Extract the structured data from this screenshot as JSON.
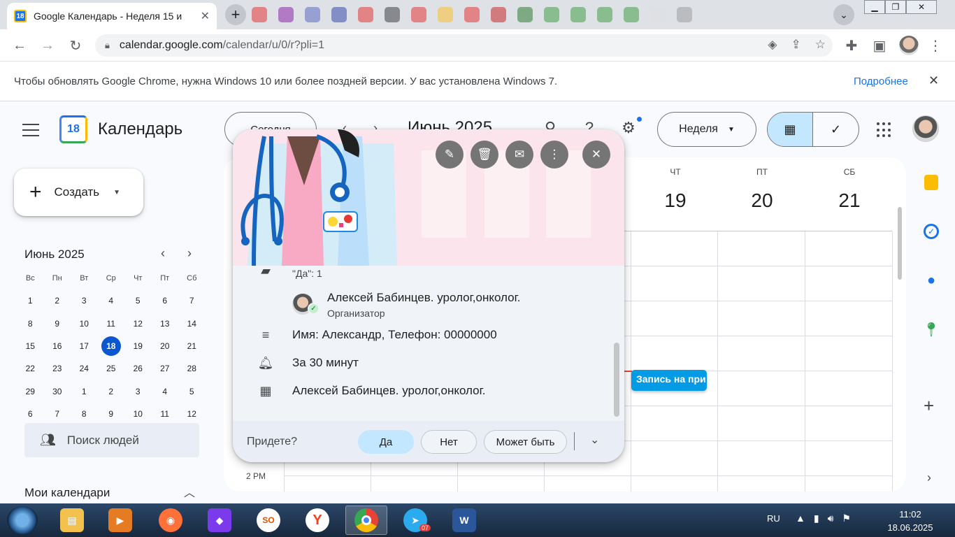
{
  "browser": {
    "tab_title": "Google Календарь - Неделя 15 и",
    "tab_favicon_day": "18",
    "url_host": "calendar.google.com",
    "url_path": "/calendar/u/0/r?pli=1",
    "mini_tab_colors": [
      "#e53935",
      "#8e24aa",
      "#5c6bc0",
      "#3949ab",
      "#e53935",
      "#424242",
      "#e53935",
      "#fbc02d",
      "#e53935",
      "#c62828",
      "#2e7d32",
      "#43a047",
      "#43a047",
      "#43a047",
      "#43a047",
      "#e0e0e0",
      "#9e9e9e"
    ]
  },
  "infobar": {
    "message": "Чтобы обновлять Google Chrome, нужна Windows 10 или более поздней версии. У вас установлена Windows 7.",
    "link": "Подробнее"
  },
  "app": {
    "title": "Календарь",
    "logo_day": "18",
    "today_button": "Сегодня",
    "period_label": "Июнь 2025",
    "view_select": "Неделя",
    "create_label": "Создать"
  },
  "mini_calendar": {
    "month_label": "Июнь 2025",
    "weekdays": [
      "Вс",
      "Пн",
      "Вт",
      "Ср",
      "Чт",
      "Пт",
      "Сб"
    ],
    "weeks": [
      [
        "1",
        "2",
        "3",
        "4",
        "5",
        "6",
        "7"
      ],
      [
        "8",
        "9",
        "10",
        "11",
        "12",
        "13",
        "14"
      ],
      [
        "15",
        "16",
        "17",
        "18",
        "19",
        "20",
        "21"
      ],
      [
        "22",
        "23",
        "24",
        "25",
        "26",
        "27",
        "28"
      ],
      [
        "29",
        "30",
        "1",
        "2",
        "3",
        "4",
        "5"
      ],
      [
        "6",
        "7",
        "8",
        "9",
        "10",
        "11",
        "12"
      ]
    ],
    "today": "18"
  },
  "sidebar": {
    "search_people": "Поиск людей",
    "my_calendars": "Мои календари"
  },
  "week": {
    "days": [
      {
        "dow": "ЧТ",
        "num": "19"
      },
      {
        "dow": "ПТ",
        "num": "20"
      },
      {
        "dow": "СБ",
        "num": "21"
      }
    ],
    "hour_label": "2 PM",
    "event_title": "Запись на при"
  },
  "popup": {
    "responses_count": "\"Да\": 1",
    "organizer_name": "Алексей Бабинцев. уролог,онколог.",
    "organizer_role": "Организатор",
    "description": "Имя: Александр, Телефон: 00000000",
    "reminder": "За 30 минут",
    "calendar_name": "Алексей Бабинцев. уролог,онколог.",
    "rsvp_question": "Придете?",
    "rsvp_yes": "Да",
    "rsvp_no": "Нет",
    "rsvp_maybe": "Может быть"
  },
  "taskbar": {
    "language": "RU",
    "time": "11:02",
    "date": "18.06.2025",
    "telegram_badge": "07"
  }
}
